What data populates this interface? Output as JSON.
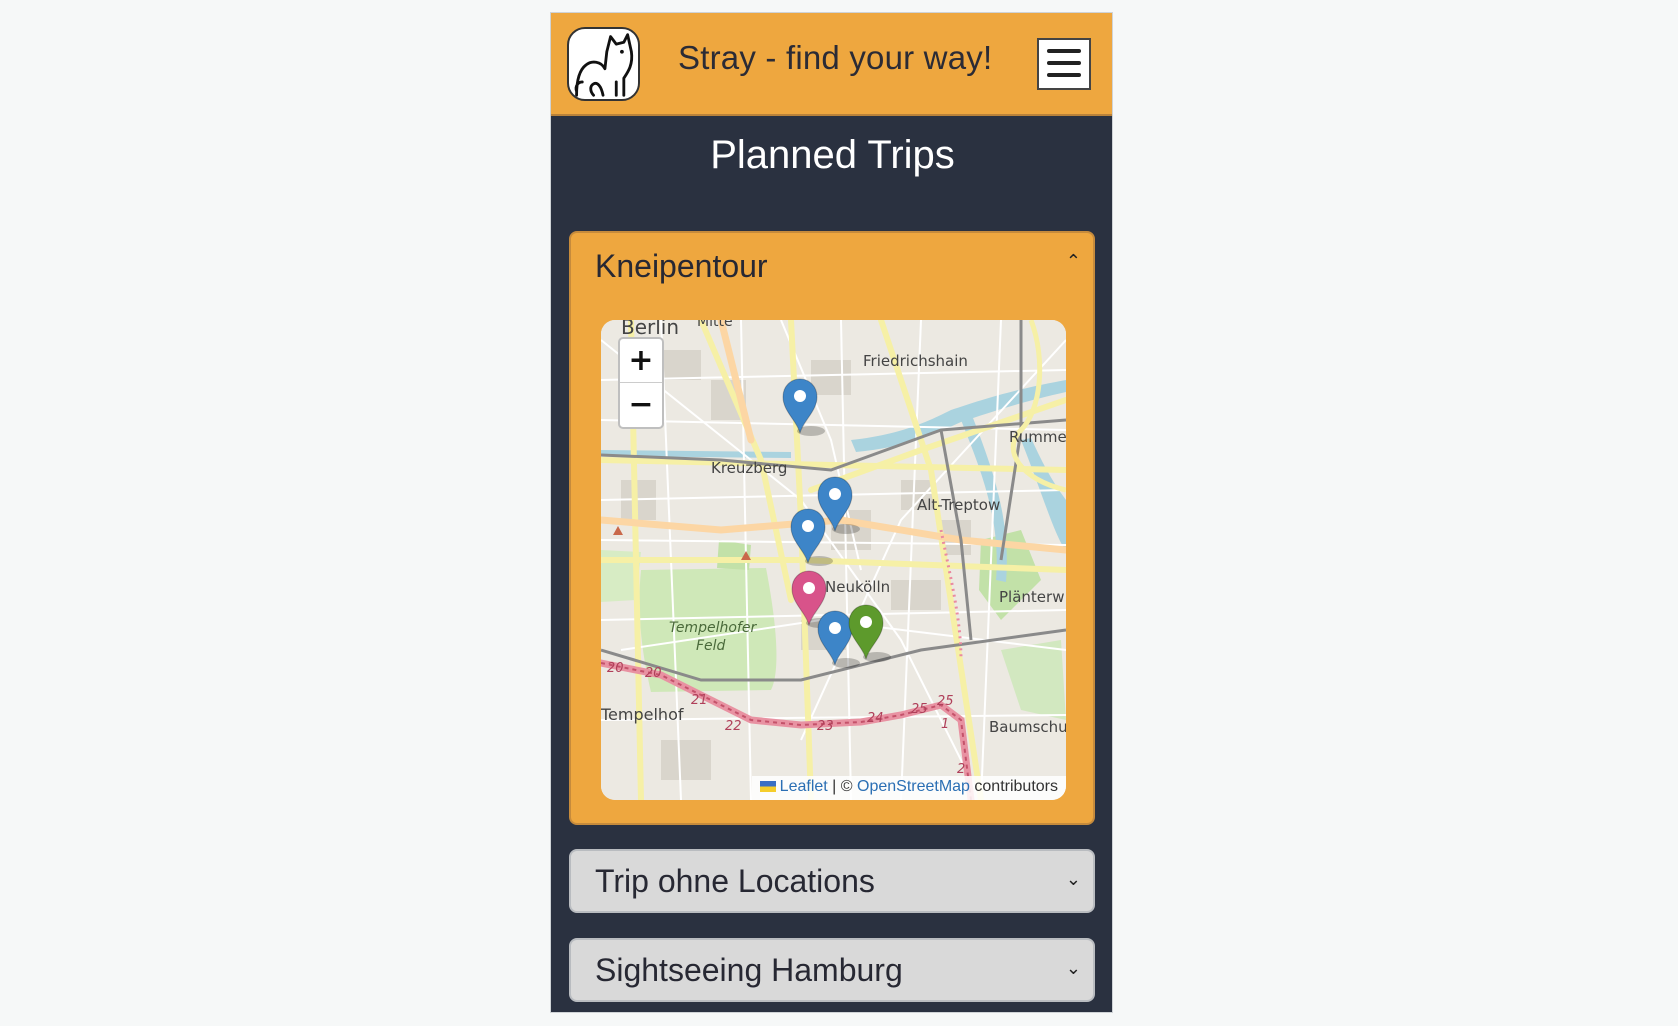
{
  "header": {
    "brand": "Stray - find your way!",
    "logo_icon": "cat-icon",
    "menu_icon": "hamburger-icon"
  },
  "page": {
    "title": "Planned Trips"
  },
  "trips": [
    {
      "name": "Kneipentour",
      "expanded": true,
      "chevron": "⌃",
      "map": {
        "zoom_in": "+",
        "zoom_out": "−",
        "place_labels": [
          "Berlin",
          "Mitte",
          "Friedrichshain",
          "Rumme",
          "Kreuzberg",
          "Alt-Treptow",
          "Neukölln",
          "Plänterw",
          "Tempelhofer",
          "Feld",
          "Tempelhof",
          "Baumschu"
        ],
        "road_numbers": [
          "20",
          "20",
          "21",
          "22",
          "23",
          "24",
          "25",
          "25",
          "1",
          "2"
        ],
        "markers": [
          {
            "color": "blue"
          },
          {
            "color": "blue"
          },
          {
            "color": "blue"
          },
          {
            "color": "pink"
          },
          {
            "color": "blue"
          },
          {
            "color": "green"
          }
        ],
        "attribution": {
          "leaflet": "Leaflet",
          "separator": " | © ",
          "osm": "OpenStreetMap",
          "suffix": " contributors"
        }
      }
    },
    {
      "name": "Trip ohne Locations",
      "expanded": false,
      "chevron": "⌄"
    },
    {
      "name": "Sightseeing Hamburg",
      "expanded": false,
      "chevron": "⌄"
    }
  ],
  "colors": {
    "header_bg": "#eea73f",
    "page_bg": "#2a3140",
    "card_closed_bg": "#d9d9d9",
    "marker_blue": "#3d85c8",
    "marker_pink": "#d8538a",
    "marker_green": "#5d9a2c",
    "link": "#2b6fb4"
  }
}
